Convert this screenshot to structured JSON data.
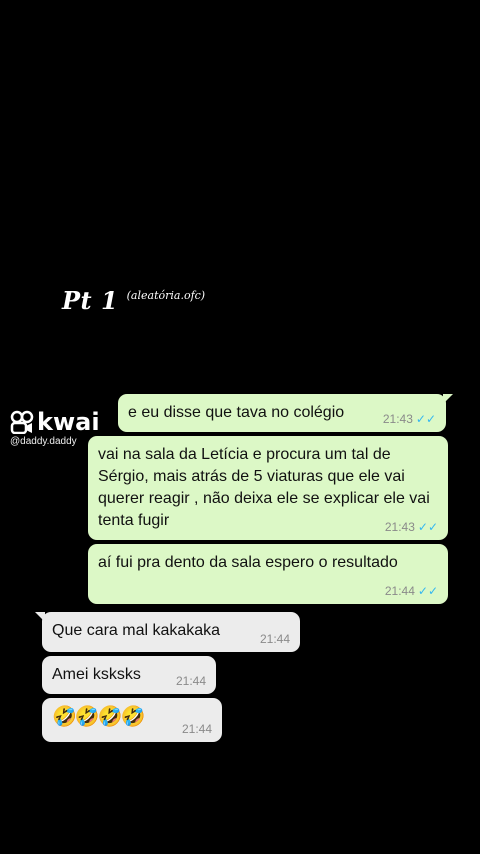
{
  "caption": {
    "title": "Pt 1",
    "handle": "(aleatória.ofc)"
  },
  "watermark": {
    "brand": "kwai",
    "user": "@daddy.daddy"
  },
  "messages": [
    {
      "text": "e eu disse que tava no colégio",
      "time": "21:43",
      "ticks": "✓✓"
    },
    {
      "text": "vai na sala da Letícia e procura um tal de Sérgio, mais atrás de 5 viaturas que ele vai querer reagir , não deixa ele se explicar ele vai tenta fugir",
      "time": "21:43",
      "ticks": "✓✓"
    },
    {
      "text": "aí fui pra dento da sala espero o resultado",
      "time": "21:44",
      "ticks": "✓✓"
    },
    {
      "text": "Que cara mal kakakaka",
      "time": "21:44"
    },
    {
      "text": "Amei ksksks",
      "time": "21:44"
    },
    {
      "text": "🤣🤣🤣🤣",
      "time": "21:44"
    }
  ],
  "colors": {
    "outgoing": "#DCF8C6",
    "incoming": "#ECECEC",
    "read_ticks": "#34B7F1",
    "background": "#000000"
  }
}
